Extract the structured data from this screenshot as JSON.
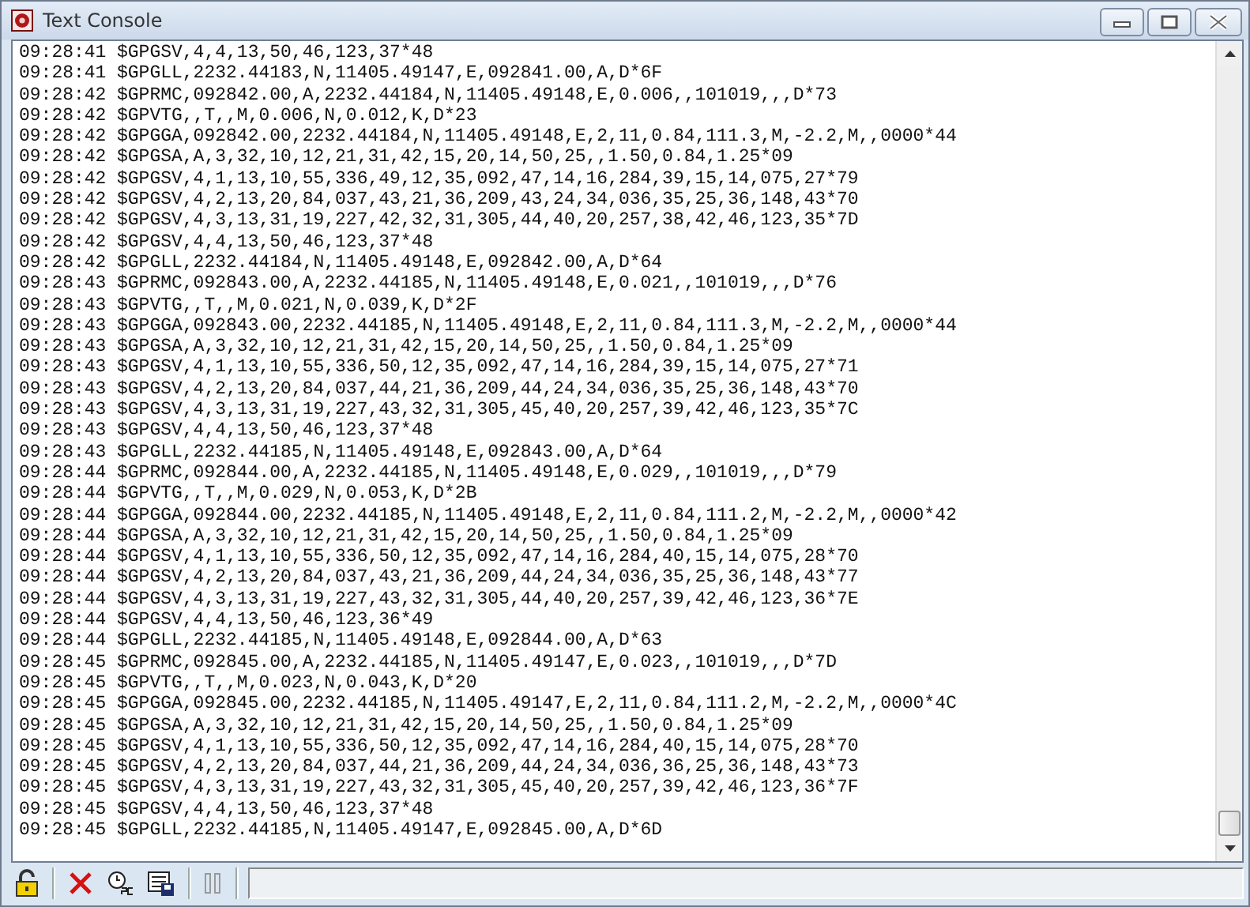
{
  "window": {
    "title": "Text Console"
  },
  "lines": [
    {
      "time": "09:28:41",
      "message": "$GPGSV,4,4,13,50,46,123,37*48"
    },
    {
      "time": "09:28:41",
      "message": "$GPGLL,2232.44183,N,11405.49147,E,092841.00,A,D*6F"
    },
    {
      "time": "09:28:42",
      "message": "$GPRMC,092842.00,A,2232.44184,N,11405.49148,E,0.006,,101019,,,D*73"
    },
    {
      "time": "09:28:42",
      "message": "$GPVTG,,T,,M,0.006,N,0.012,K,D*23"
    },
    {
      "time": "09:28:42",
      "message": "$GPGGA,092842.00,2232.44184,N,11405.49148,E,2,11,0.84,111.3,M,-2.2,M,,0000*44"
    },
    {
      "time": "09:28:42",
      "message": "$GPGSA,A,3,32,10,12,21,31,42,15,20,14,50,25,,1.50,0.84,1.25*09"
    },
    {
      "time": "09:28:42",
      "message": "$GPGSV,4,1,13,10,55,336,49,12,35,092,47,14,16,284,39,15,14,075,27*79"
    },
    {
      "time": "09:28:42",
      "message": "$GPGSV,4,2,13,20,84,037,43,21,36,209,43,24,34,036,35,25,36,148,43*70"
    },
    {
      "time": "09:28:42",
      "message": "$GPGSV,4,3,13,31,19,227,42,32,31,305,44,40,20,257,38,42,46,123,35*7D"
    },
    {
      "time": "09:28:42",
      "message": "$GPGSV,4,4,13,50,46,123,37*48"
    },
    {
      "time": "09:28:42",
      "message": "$GPGLL,2232.44184,N,11405.49148,E,092842.00,A,D*64"
    },
    {
      "time": "09:28:43",
      "message": "$GPRMC,092843.00,A,2232.44185,N,11405.49148,E,0.021,,101019,,,D*76"
    },
    {
      "time": "09:28:43",
      "message": "$GPVTG,,T,,M,0.021,N,0.039,K,D*2F"
    },
    {
      "time": "09:28:43",
      "message": "$GPGGA,092843.00,2232.44185,N,11405.49148,E,2,11,0.84,111.3,M,-2.2,M,,0000*44"
    },
    {
      "time": "09:28:43",
      "message": "$GPGSA,A,3,32,10,12,21,31,42,15,20,14,50,25,,1.50,0.84,1.25*09"
    },
    {
      "time": "09:28:43",
      "message": "$GPGSV,4,1,13,10,55,336,50,12,35,092,47,14,16,284,39,15,14,075,27*71"
    },
    {
      "time": "09:28:43",
      "message": "$GPGSV,4,2,13,20,84,037,44,21,36,209,44,24,34,036,35,25,36,148,43*70"
    },
    {
      "time": "09:28:43",
      "message": "$GPGSV,4,3,13,31,19,227,43,32,31,305,45,40,20,257,39,42,46,123,35*7C"
    },
    {
      "time": "09:28:43",
      "message": "$GPGSV,4,4,13,50,46,123,37*48"
    },
    {
      "time": "09:28:43",
      "message": "$GPGLL,2232.44185,N,11405.49148,E,092843.00,A,D*64"
    },
    {
      "time": "09:28:44",
      "message": "$GPRMC,092844.00,A,2232.44185,N,11405.49148,E,0.029,,101019,,,D*79"
    },
    {
      "time": "09:28:44",
      "message": "$GPVTG,,T,,M,0.029,N,0.053,K,D*2B"
    },
    {
      "time": "09:28:44",
      "message": "$GPGGA,092844.00,2232.44185,N,11405.49148,E,2,11,0.84,111.2,M,-2.2,M,,0000*42"
    },
    {
      "time": "09:28:44",
      "message": "$GPGSA,A,3,32,10,12,21,31,42,15,20,14,50,25,,1.50,0.84,1.25*09"
    },
    {
      "time": "09:28:44",
      "message": "$GPGSV,4,1,13,10,55,336,50,12,35,092,47,14,16,284,40,15,14,075,28*70"
    },
    {
      "time": "09:28:44",
      "message": "$GPGSV,4,2,13,20,84,037,43,21,36,209,44,24,34,036,35,25,36,148,43*77"
    },
    {
      "time": "09:28:44",
      "message": "$GPGSV,4,3,13,31,19,227,43,32,31,305,44,40,20,257,39,42,46,123,36*7E"
    },
    {
      "time": "09:28:44",
      "message": "$GPGSV,4,4,13,50,46,123,36*49"
    },
    {
      "time": "09:28:44",
      "message": "$GPGLL,2232.44185,N,11405.49148,E,092844.00,A,D*63"
    },
    {
      "time": "09:28:45",
      "message": "$GPRMC,092845.00,A,2232.44185,N,11405.49147,E,0.023,,101019,,,D*7D"
    },
    {
      "time": "09:28:45",
      "message": "$GPVTG,,T,,M,0.023,N,0.043,K,D*20"
    },
    {
      "time": "09:28:45",
      "message": "$GPGGA,092845.00,2232.44185,N,11405.49147,E,2,11,0.84,111.2,M,-2.2,M,,0000*4C"
    },
    {
      "time": "09:28:45",
      "message": "$GPGSA,A,3,32,10,12,21,31,42,15,20,14,50,25,,1.50,0.84,1.25*09"
    },
    {
      "time": "09:28:45",
      "message": "$GPGSV,4,1,13,10,55,336,50,12,35,092,47,14,16,284,40,15,14,075,28*70"
    },
    {
      "time": "09:28:45",
      "message": "$GPGSV,4,2,13,20,84,037,44,21,36,209,44,24,34,036,36,25,36,148,43*73"
    },
    {
      "time": "09:28:45",
      "message": "$GPGSV,4,3,13,31,19,227,43,32,31,305,45,40,20,257,39,42,46,123,36*7F"
    },
    {
      "time": "09:28:45",
      "message": "$GPGSV,4,4,13,50,46,123,37*48"
    },
    {
      "time": "09:28:45",
      "message": "$GPGLL,2232.44185,N,11405.49147,E,092845.00,A,D*6D"
    }
  ]
}
